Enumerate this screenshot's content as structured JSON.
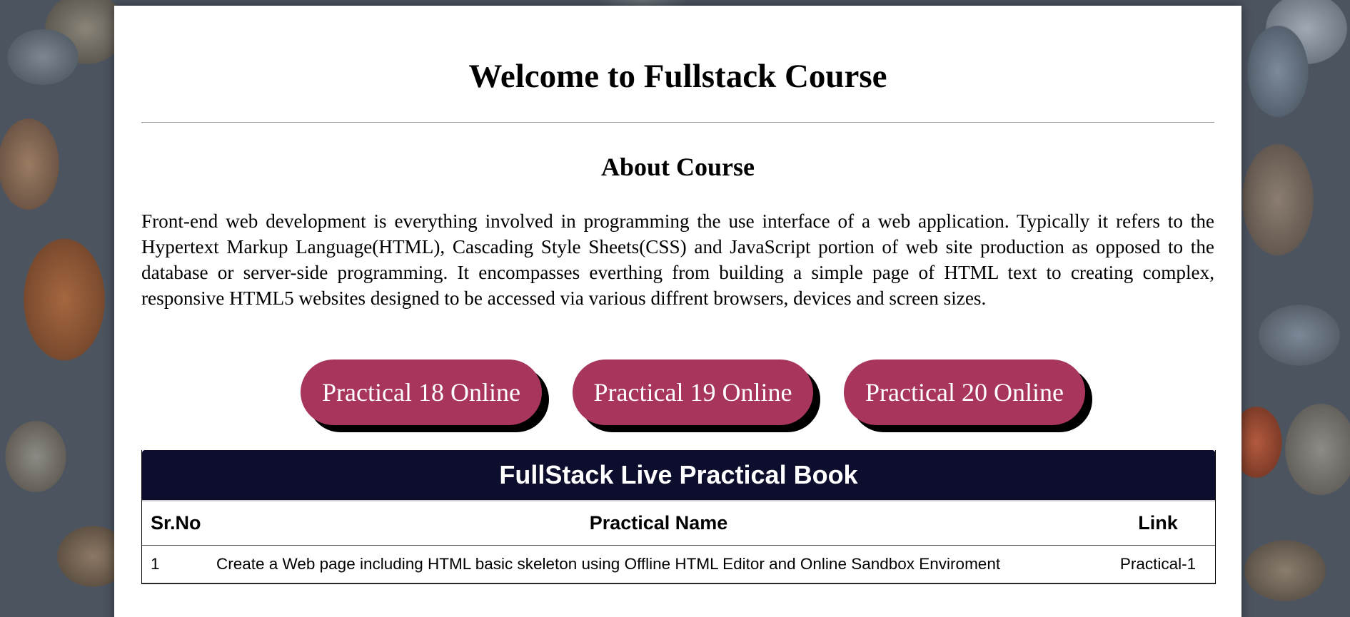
{
  "page": {
    "title": "Welcome to Fullstack Course",
    "about_heading": "About Course",
    "about_text": "Front-end web development is everything involved in programming the use interface of a web application. Typically it refers to the Hypertext Markup Language(HTML), Cascading Style Sheets(CSS) and JavaScript portion of web site production as opposed to the database or server-side programming. It encompasses everthing from building a simple page of HTML text to creating complex, responsive HTML5 websites designed to be accessed via various diffrent browsers, devices and screen sizes."
  },
  "buttons": [
    {
      "label": "Practical 18 Online"
    },
    {
      "label": "Practical 19 Online"
    },
    {
      "label": "Practical 20 Online"
    }
  ],
  "table": {
    "caption": "FullStack Live Practical Book",
    "headers": {
      "sr": "Sr.No",
      "name": "Practical Name",
      "link": "Link"
    },
    "rows": [
      {
        "sr": "1",
        "name": "Create a Web page including HTML basic skeleton using Offline HTML Editor and Online Sandbox Enviroment",
        "link": "Practical-1"
      }
    ]
  },
  "colors": {
    "button": "#a8365c",
    "button_shadow": "#000000",
    "table_caption_bg": "#0d0e2d",
    "card_bg": "#ffffff"
  }
}
